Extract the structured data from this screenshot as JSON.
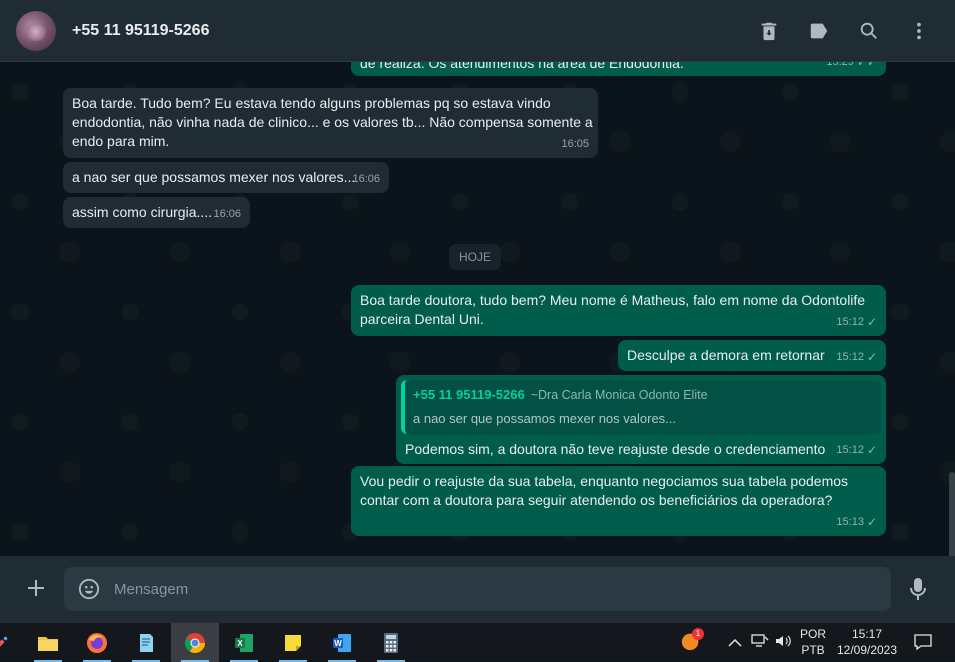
{
  "header": {
    "contact_name": "+55 11 95119-5266",
    "icons": [
      "delete-icon",
      "label-icon",
      "search-icon",
      "menu-icon"
    ]
  },
  "messages": [
    {
      "direction": "out",
      "text": "de realiza. Os atendimentos na área de Endodontia.",
      "time": "15:29",
      "status": "read"
    },
    {
      "direction": "in",
      "text": "Boa tarde. Tudo bem? Eu estava tendo alguns problemas pq so estava vindo endodontia, não vinha nada de clinico... e os valores tb... Não compensa somente a endo para mim.",
      "time": "16:05"
    },
    {
      "direction": "in",
      "text": "a nao ser que possamos mexer nos valores...",
      "time": "16:06"
    },
    {
      "direction": "in",
      "text": "assim como cirurgia....",
      "time": "16:06"
    },
    {
      "direction": "out",
      "text": "Boa tarde doutora, tudo bem? Meu nome é Matheus, falo em nome da Odontolife parceira Dental Uni.",
      "time": "15:12",
      "status": "sent"
    },
    {
      "direction": "out",
      "text": "Desculpe a demora em retornar",
      "time": "15:12",
      "status": "sent"
    },
    {
      "direction": "out",
      "quote": {
        "name": "+55 11 95119-5266",
        "alias": "~Dra Carla Monica Odonto Elite",
        "text": "a nao ser que possamos mexer nos valores..."
      },
      "text": "Podemos sim, a doutora não teve reajuste desde o credenciamento",
      "time": "15:12",
      "status": "sent"
    },
    {
      "direction": "out",
      "text": "Vou pedir o reajuste da sua tabela, enquanto negociamos sua tabela podemos contar com a doutora para seguir atendendo os beneficiários da operadora?",
      "time": "15:13",
      "status": "sent"
    }
  ],
  "day_separator": "HOJE",
  "composer": {
    "placeholder": "Mensagem"
  },
  "taskbar": {
    "apps": [
      "file-explorer",
      "firefox",
      "notepad",
      "chrome",
      "excel",
      "sticky-notes",
      "word",
      "calculator"
    ],
    "language": "POR",
    "layout": "PTB",
    "time": "15:17",
    "date": "12/09/2023",
    "notification_badge": "1"
  },
  "colors": {
    "incoming": "#202c33",
    "outgoing": "#005c4b",
    "accent": "#06cf9c",
    "background": "#0b141a"
  }
}
